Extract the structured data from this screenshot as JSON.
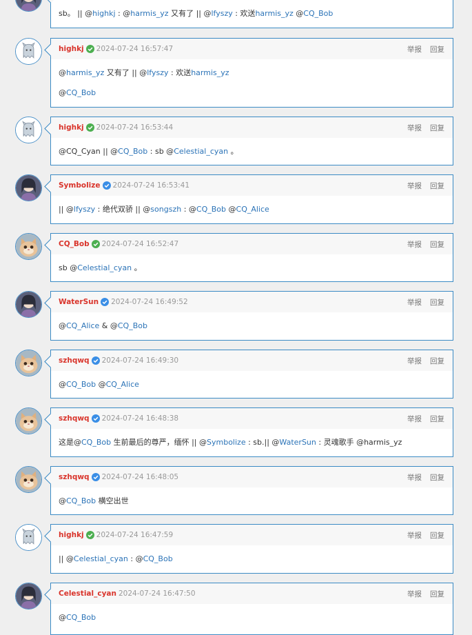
{
  "comments": [
    {
      "avatar_icon": "anime-girl-avatar-icon",
      "username": "",
      "badge": "",
      "time": "",
      "actions": [],
      "lines": [
        [
          {
            "t": "sb。 || @"
          },
          {
            "t": "highkj",
            "m": true
          },
          {
            "t": " : @"
          },
          {
            "t": "harmis_yz",
            "m": true
          },
          {
            "t": " 又有了 || @"
          },
          {
            "t": "lfyszy",
            "m": true
          },
          {
            "t": " : 欢送"
          },
          {
            "t": "harmis_yz",
            "m": true
          },
          {
            "t": " @"
          },
          {
            "t": "CQ_Bob",
            "m": true
          }
        ]
      ]
    },
    {
      "avatar_icon": "ghost-cat-avatar-icon",
      "username": "highkj",
      "badge": "green",
      "time": "2024-07-24 16:57:47",
      "actions": [
        "举报",
        "回复"
      ],
      "lines": [
        [
          {
            "t": "@"
          },
          {
            "t": "harmis_yz",
            "m": true
          },
          {
            "t": " 又有了 || @"
          },
          {
            "t": "lfyszy",
            "m": true
          },
          {
            "t": " : 欢送"
          },
          {
            "t": "harmis_yz",
            "m": true
          }
        ],
        [
          {
            "t": "@"
          },
          {
            "t": "CQ_Bob",
            "m": true
          }
        ]
      ]
    },
    {
      "avatar_icon": "ghost-cat-avatar-icon",
      "username": "highkj",
      "badge": "green",
      "time": "2024-07-24 16:53:44",
      "actions": [
        "举报",
        "回复"
      ],
      "lines": [
        [
          {
            "t": "@CQ_Cyan || @"
          },
          {
            "t": "CQ_Bob",
            "m": true
          },
          {
            "t": " : sb @"
          },
          {
            "t": "Celestial_cyan",
            "m": true
          },
          {
            "t": " 。"
          }
        ]
      ]
    },
    {
      "avatar_icon": "anime-character-avatar-icon",
      "username": "Symbolize",
      "badge": "blue",
      "time": "2024-07-24 16:53:41",
      "actions": [
        "举报",
        "回复"
      ],
      "lines": [
        [
          {
            "t": "|| @"
          },
          {
            "t": "lfyszy",
            "m": true
          },
          {
            "t": " : 绝代双骄 || @"
          },
          {
            "t": "songszh",
            "m": true
          },
          {
            "t": " : @"
          },
          {
            "t": "CQ_Bob",
            "m": true
          },
          {
            "t": " @"
          },
          {
            "t": "CQ_Alice",
            "m": true
          }
        ]
      ]
    },
    {
      "avatar_icon": "cat-avatar-icon",
      "username": "CQ_Bob",
      "badge": "green",
      "time": "2024-07-24 16:52:47",
      "actions": [
        "举报",
        "回复"
      ],
      "lines": [
        [
          {
            "t": "sb @"
          },
          {
            "t": "Celestial_cyan",
            "m": true
          },
          {
            "t": " 。"
          }
        ]
      ]
    },
    {
      "avatar_icon": "anime-character-avatar-icon",
      "username": "WaterSun",
      "badge": "blue",
      "time": "2024-07-24 16:49:52",
      "actions": [
        "举报",
        "回复"
      ],
      "lines": [
        [
          {
            "t": "@"
          },
          {
            "t": "CQ_Alice",
            "m": true
          },
          {
            "t": " & @"
          },
          {
            "t": "CQ_Bob",
            "m": true
          }
        ]
      ]
    },
    {
      "avatar_icon": "cat-avatar-icon",
      "username": "szhqwq",
      "badge": "blue",
      "time": "2024-07-24 16:49:30",
      "actions": [
        "举报",
        "回复"
      ],
      "lines": [
        [
          {
            "t": "@"
          },
          {
            "t": "CQ_Bob",
            "m": true
          },
          {
            "t": " @"
          },
          {
            "t": "CQ_Alice",
            "m": true
          }
        ]
      ]
    },
    {
      "avatar_icon": "cat-avatar-icon",
      "username": "szhqwq",
      "badge": "blue",
      "time": "2024-07-24 16:48:38",
      "actions": [
        "举报",
        "回复"
      ],
      "lines": [
        [
          {
            "t": "这是@"
          },
          {
            "t": "CQ_Bob",
            "m": true
          },
          {
            "t": " 生前最后的尊严，缅怀 || @"
          },
          {
            "t": "Symbolize",
            "m": true
          },
          {
            "t": " : sb.|| @"
          },
          {
            "t": "WaterSun",
            "m": true
          },
          {
            "t": " : 灵魂歌手 @harmis_yz"
          }
        ]
      ]
    },
    {
      "avatar_icon": "cat-avatar-icon",
      "username": "szhqwq",
      "badge": "blue",
      "time": "2024-07-24 16:48:05",
      "actions": [
        "举报",
        "回复"
      ],
      "lines": [
        [
          {
            "t": "@"
          },
          {
            "t": "CQ_Bob",
            "m": true
          },
          {
            "t": " 横空出世"
          }
        ]
      ]
    },
    {
      "avatar_icon": "ghost-cat-avatar-icon",
      "username": "highkj",
      "badge": "green",
      "time": "2024-07-24 16:47:59",
      "actions": [
        "举报",
        "回复"
      ],
      "lines": [
        [
          {
            "t": "|| @"
          },
          {
            "t": "Celestial_cyan",
            "m": true
          },
          {
            "t": " : @"
          },
          {
            "t": "CQ_Bob",
            "m": true
          }
        ]
      ]
    },
    {
      "avatar_icon": "anime-character-avatar-icon",
      "username": "Celestial_cyan",
      "badge": "",
      "time": "2024-07-24 16:47:50",
      "actions": [
        "举报",
        "回复"
      ],
      "lines": [
        [
          {
            "t": "@"
          },
          {
            "t": "CQ_Bob",
            "m": true
          }
        ]
      ]
    }
  ],
  "colors": {
    "username": "#d9342b",
    "mention": "#2b73b7",
    "border": "#3a8ac4",
    "badge_green": "#4caf50",
    "badge_blue": "#3a8ee6"
  }
}
